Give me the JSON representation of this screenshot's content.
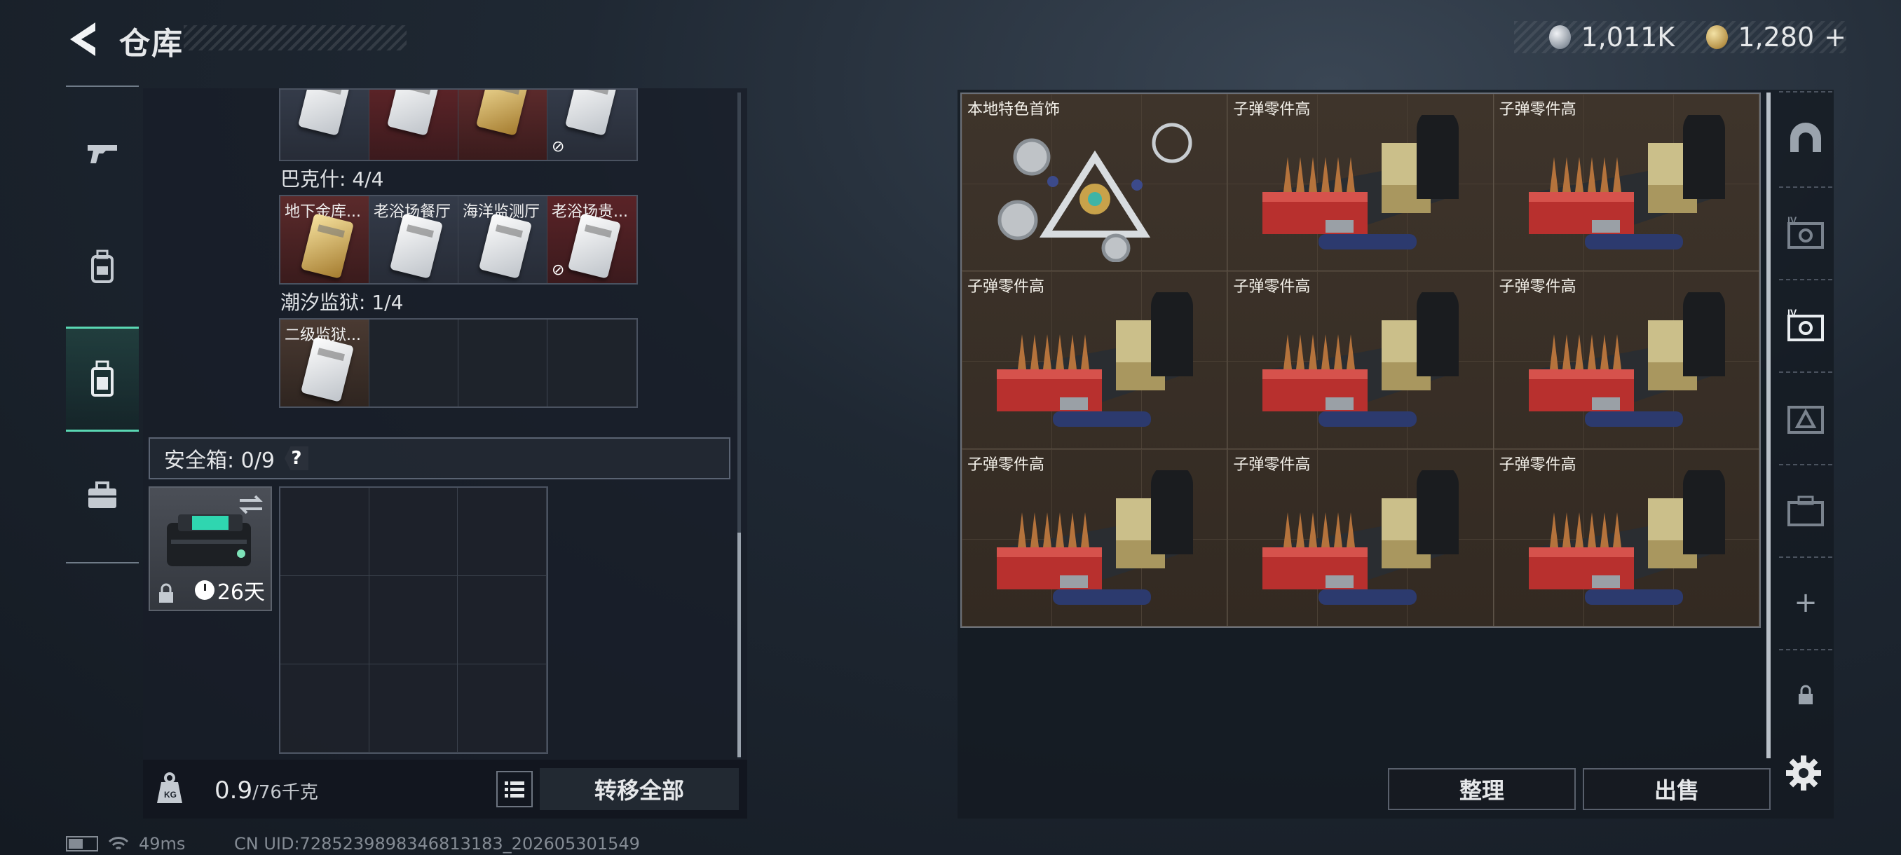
{
  "header": {
    "title": "仓库",
    "currency_silver": "1,011K",
    "currency_gold": "1,280",
    "add_label": "+"
  },
  "left_panel": {
    "sections": [
      {
        "label": "巴克什: 4/4",
        "cells": [
          "地下金库...",
          "老浴场餐厅",
          "海洋监测厅",
          "老浴场贵..."
        ]
      },
      {
        "label": "潮汐监狱: 1/4",
        "cells": [
          "二级监狱..."
        ]
      }
    ],
    "safebox": {
      "label": "安全箱: 0/9",
      "help": "?",
      "item_time": "26天"
    },
    "footer": {
      "weight_value": "0.9",
      "weight_cap": "/76千克",
      "transfer_label": "转移全部"
    }
  },
  "stash": {
    "items": [
      "本地特色首饰",
      "子弹零件高",
      "子弹零件高",
      "子弹零件高",
      "子弹零件高",
      "子弹零件高",
      "子弹零件高",
      "子弹零件高",
      "子弹零件高"
    ]
  },
  "right_nav": {
    "add_label": "+"
  },
  "actions": {
    "sort_label": "整理",
    "sell_label": "出售"
  },
  "status": {
    "ping": "49ms",
    "uid": "CN UID:7285239898346813183_202605301549"
  }
}
